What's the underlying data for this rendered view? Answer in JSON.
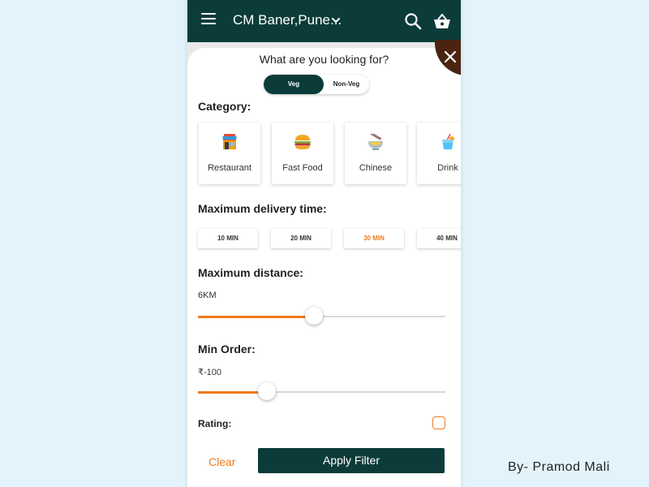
{
  "appbar": {
    "location": "CM Baner,Pune...",
    "icons": [
      "menu-icon",
      "chevron-down-icon",
      "search-icon",
      "basket-icon"
    ]
  },
  "filter": {
    "heading": "What are you looking for?",
    "diet_toggle": {
      "options": [
        "Veg",
        "Non-Veg"
      ],
      "selected": "Veg"
    },
    "category": {
      "title": "Category:",
      "items": [
        {
          "label": "Restaurant",
          "icon": "restaurant-icon"
        },
        {
          "label": "Fast Food",
          "icon": "burger-icon"
        },
        {
          "label": "Chinese",
          "icon": "noodle-bowl-icon"
        },
        {
          "label": "Drink",
          "icon": "drink-icon"
        }
      ]
    },
    "delivery_time": {
      "title": "Maximum delivery time:",
      "options": [
        "10 MIN",
        "20 MIN",
        "30 MIN",
        "40 MIN"
      ],
      "selected": "30 MIN"
    },
    "distance": {
      "title": "Maximum distance:",
      "value_text": "6KM",
      "slider_fraction": 0.47
    },
    "min_order": {
      "title": "Min Order:",
      "value_text": "₹-100",
      "slider_fraction": 0.28
    },
    "rating": {
      "label": "Rating:",
      "checked": false
    },
    "clear_label": "Clear",
    "apply_label": "Apply Filter"
  },
  "credit": "By- Pramod Mali",
  "colors": {
    "primary": "#0b3c3a",
    "accent": "#f07b1a",
    "close_bg": "#4a2411",
    "background": "#e3f3fb"
  }
}
